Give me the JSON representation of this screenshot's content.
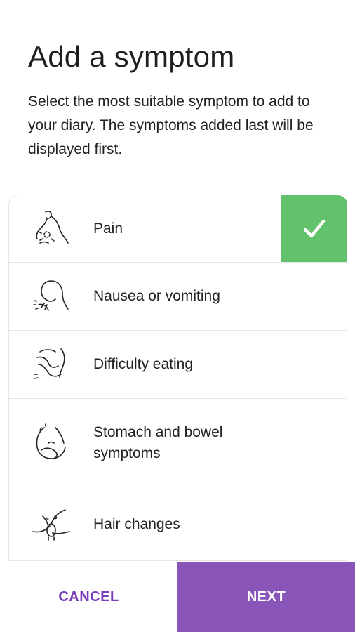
{
  "header": {
    "title": "Add a symptom",
    "description": "Select the most suitable symptom to add to your diary. The symptoms added last will be displayed first."
  },
  "symptoms": [
    {
      "label": "Pain",
      "icon": "pain-icon",
      "selected": true
    },
    {
      "label": "Nausea or vomiting",
      "icon": "nausea-icon",
      "selected": false
    },
    {
      "label": "Difficulty eating",
      "icon": "eating-icon",
      "selected": false
    },
    {
      "label": "Stomach and bowel symptoms",
      "icon": "stomach-icon",
      "selected": false
    },
    {
      "label": "Hair changes",
      "icon": "hair-icon",
      "selected": false
    }
  ],
  "footer": {
    "cancel_label": "CANCEL",
    "next_label": "NEXT"
  },
  "colors": {
    "selected": "#62c26c",
    "accent": "#8a55b9",
    "cancel_text": "#7a3fb8"
  }
}
